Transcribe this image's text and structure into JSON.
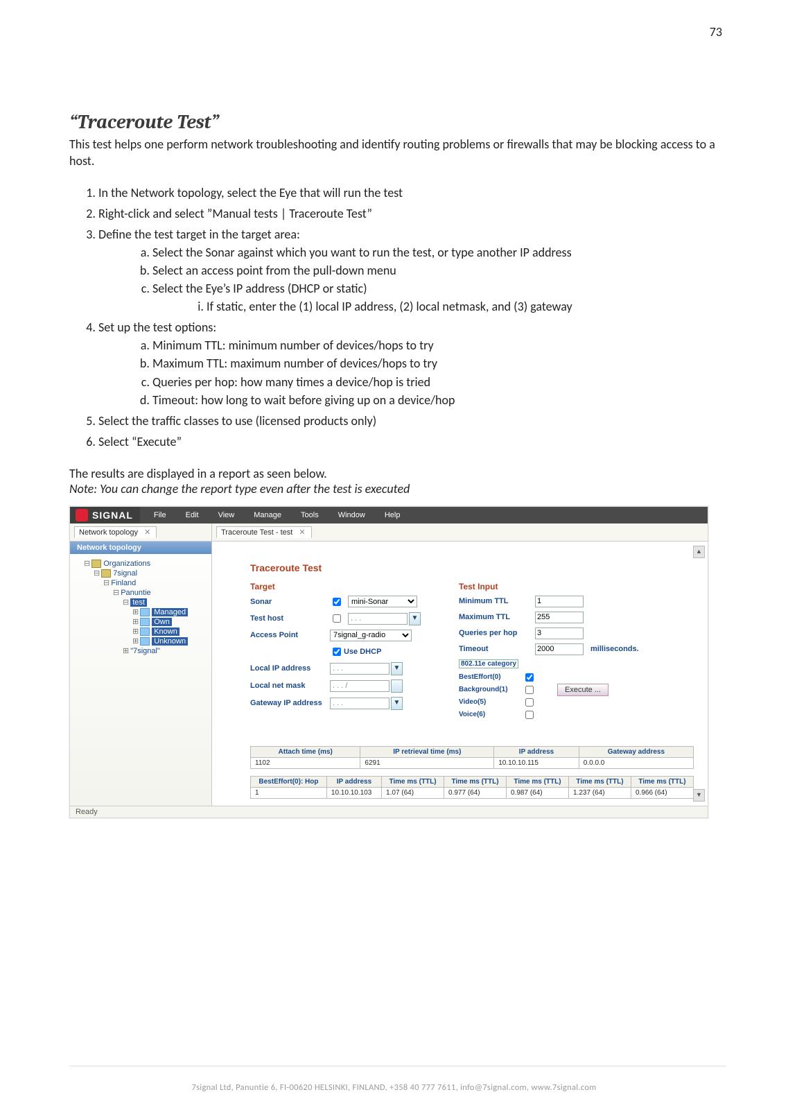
{
  "page_number": "73",
  "heading": "“Traceroute Test”",
  "intro": "This test helps one perform network troubleshooting and identify routing problems or firewalls that may be blocking access to a host.",
  "steps": {
    "s1": "In the Network topology, select the Eye that will run the test",
    "s2": "Right-click and select ”Manual tests | Traceroute Test”",
    "s3": "Define the test target in the target area:",
    "s3a": "Select the Sonar against which you want to run the test, or type another IP address",
    "s3b": "Select an access point from the pull-down menu",
    "s3c": "Select the Eye’s IP address (DHCP or static)",
    "s3c_i": "If static, enter the (1) local IP address, (2) local netmask, and (3) gateway",
    "s4": "Set up the test options:",
    "s4a": "Minimum TTL: minimum number of devices/hops to try",
    "s4b": "Maximum TTL: maximum number of devices/hops to try",
    "s4c": "Queries per hop: how many times a device/hop is tried",
    "s4d": "Timeout: how long to wait before giving up on a device/hop",
    "s5": "Select the traffic classes to use (licensed products only)",
    "s6": "Select “Execute”"
  },
  "results_text": "The results are displayed in a report as seen below.",
  "note_text": "Note: You can change the report type even after the test is executed",
  "app": {
    "logo": "SIGNAL",
    "menu": {
      "file": "File",
      "edit": "Edit",
      "view": "View",
      "manage": "Manage",
      "tools": "Tools",
      "window": "Window",
      "help": "Help"
    },
    "left_tab": "Network topology",
    "right_tab": "Traceroute Test - test",
    "nettop_header": "Network topology",
    "tree": {
      "root": "Organizations",
      "n1": "7signal",
      "n2": "Finland",
      "n3": "Panuntie",
      "n4": "test",
      "n4a": "Managed",
      "n4b": "Own",
      "n4c": "Known",
      "n4d": "Unknown",
      "n5": "\"7signal\""
    },
    "section_title": "Traceroute Test",
    "target": {
      "title": "Target",
      "sonar_lbl": "Sonar",
      "sonar_val": "mini-Sonar",
      "testhost_lbl": "Test host",
      "ap_lbl": "Access Point",
      "ap_val": "7signal_g-radio",
      "usedhcp": "Use DHCP",
      "localip_lbl": "Local IP address",
      "netmask_lbl": "Local net mask",
      "gateway_lbl": "Gateway IP address",
      "mask_placeholder": "  .   .   .   ",
      "mask_placeholder_slash": "  .   .   .   /"
    },
    "input": {
      "title": "Test Input",
      "minttl_lbl": "Minimum TTL",
      "minttl_val": "1",
      "maxttl_lbl": "Maximum TTL",
      "maxttl_val": "255",
      "qph_lbl": "Queries per hop",
      "qph_val": "3",
      "timeout_lbl": "Timeout",
      "timeout_val": "2000",
      "timeout_unit": "milliseconds.",
      "cat_header": "802.11e category",
      "besteffort": "BestEffort(0)",
      "background": "Background(1)",
      "video": "Video(5)",
      "voice": "Voice(6)",
      "execute": "Execute ..."
    },
    "table1": {
      "h1": "Attach time (ms)",
      "h2": "IP retrieval time (ms)",
      "h3": "IP address",
      "h4": "Gateway address",
      "r1c1": "1102",
      "r1c2": "6291",
      "r1c3": "10.10.10.115",
      "r1c4": "0.0.0.0"
    },
    "table2": {
      "h1": "BestEffort(0): Hop",
      "h2": "IP address",
      "h3": "Time ms (TTL)",
      "h4": "Time ms (TTL)",
      "h5": "Time ms (TTL)",
      "h6": "Time ms (TTL)",
      "h7": "Time ms (TTL)",
      "r1c1": "1",
      "r1c2": "10.10.10.103",
      "r1c3": "1.07 (64)",
      "r1c4": "0.977 (64)",
      "r1c5": "0.987 (64)",
      "r1c6": "1.237 (64)",
      "r1c7": "0.966 (64)"
    },
    "status": "Ready"
  },
  "footer": "7signal Ltd, Panuntie 6, FI-00620 HELSINKI, FINLAND, +358 40 777 7611, info@7signal.com, www.7signal.com"
}
